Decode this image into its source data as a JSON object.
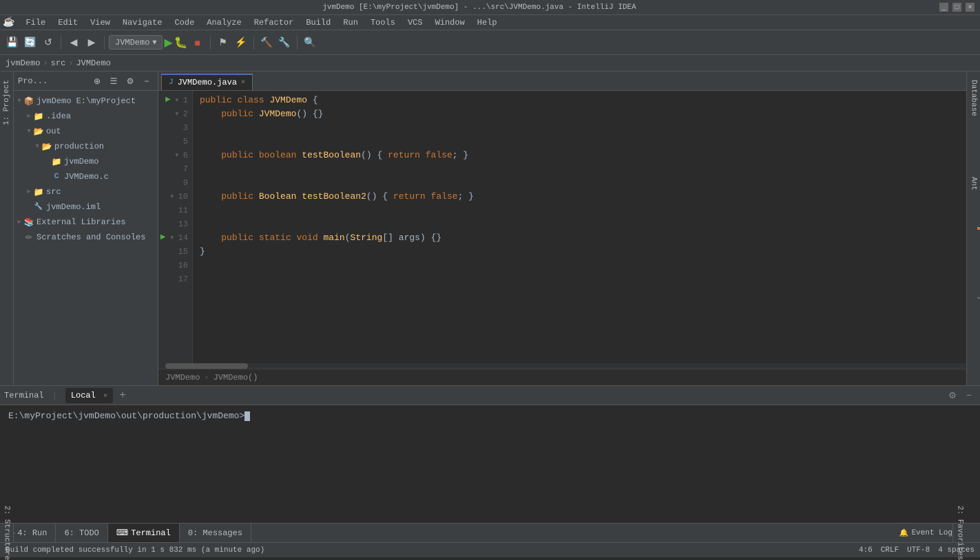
{
  "titleBar": {
    "title": "jvmDemo [E:\\myProject\\jvmDemo] - ...\\src\\JVMDemo.java - IntelliJ IDEA",
    "minimize": "_",
    "maximize": "□",
    "close": "×"
  },
  "menuBar": {
    "items": [
      "File",
      "Edit",
      "View",
      "Navigate",
      "Code",
      "Analyze",
      "Refactor",
      "Build",
      "Run",
      "Tools",
      "VCS",
      "Window",
      "Help"
    ]
  },
  "toolbar": {
    "runConfig": "JVMDemo",
    "buttons": [
      "save",
      "sync",
      "refresh",
      "back",
      "forward",
      "run",
      "debug",
      "stop",
      "build",
      "coverage",
      "profiler",
      "search"
    ]
  },
  "navBreadcrumb": {
    "items": [
      "jvmDemo",
      "src",
      "JVMDemo"
    ]
  },
  "projectPanel": {
    "title": "Pro...",
    "tree": [
      {
        "label": "jvmDemo E:\\myProject",
        "level": 0,
        "type": "module",
        "expanded": true,
        "hasArrow": true
      },
      {
        "label": ".idea",
        "level": 1,
        "type": "folder",
        "expanded": false,
        "hasArrow": true
      },
      {
        "label": "out",
        "level": 1,
        "type": "folder",
        "expanded": true,
        "hasArrow": true
      },
      {
        "label": "production",
        "level": 2,
        "type": "folder",
        "expanded": true,
        "hasArrow": true
      },
      {
        "label": "jvmDemo",
        "level": 3,
        "type": "folder",
        "expanded": false,
        "hasArrow": false
      },
      {
        "label": "JVMDemo.c",
        "level": 3,
        "type": "java",
        "expanded": false,
        "hasArrow": false
      },
      {
        "label": "src",
        "level": 1,
        "type": "folder",
        "expanded": false,
        "hasArrow": true
      },
      {
        "label": "jvmDemo.iml",
        "level": 1,
        "type": "iml",
        "expanded": false,
        "hasArrow": false
      },
      {
        "label": "External Libraries",
        "level": 0,
        "type": "folder",
        "expanded": false,
        "hasArrow": true
      },
      {
        "label": "Scratches and Consoles",
        "level": 0,
        "type": "folder",
        "expanded": false,
        "hasArrow": false
      }
    ]
  },
  "editorTabs": [
    {
      "label": "JVMDemo.java",
      "active": true
    }
  ],
  "codeLines": [
    {
      "num": 1,
      "runGutter": true,
      "foldGutter": false,
      "content": "public class JVMDemo {"
    },
    {
      "num": 2,
      "runGutter": false,
      "foldGutter": false,
      "content": "    public JVMDemo() {}"
    },
    {
      "num": 3,
      "runGutter": false,
      "foldGutter": false,
      "content": ""
    },
    {
      "num": 5,
      "runGutter": false,
      "foldGutter": false,
      "content": ""
    },
    {
      "num": 6,
      "runGutter": false,
      "foldGutter": true,
      "content": "    public boolean testBoolean() { return false; }"
    },
    {
      "num": 7,
      "runGutter": false,
      "foldGutter": false,
      "content": ""
    },
    {
      "num": 9,
      "runGutter": false,
      "foldGutter": false,
      "content": ""
    },
    {
      "num": 10,
      "runGutter": false,
      "foldGutter": true,
      "content": "    public Boolean testBoolean2() { return false; }"
    },
    {
      "num": 11,
      "runGutter": false,
      "foldGutter": false,
      "content": ""
    },
    {
      "num": 13,
      "runGutter": false,
      "foldGutter": false,
      "content": ""
    },
    {
      "num": 14,
      "runGutter": true,
      "foldGutter": true,
      "content": "    public static void main(String[] args) {}"
    },
    {
      "num": 15,
      "runGutter": false,
      "foldGutter": false,
      "content": "}"
    },
    {
      "num": 16,
      "runGutter": false,
      "foldGutter": false,
      "content": ""
    },
    {
      "num": 17,
      "runGutter": false,
      "foldGutter": false,
      "content": ""
    }
  ],
  "editorBreadcrumb": {
    "items": [
      "JVMDemo",
      "JVMDemo()"
    ]
  },
  "rightTabs": {
    "database": "Database",
    "ant": "Ant"
  },
  "terminalPanel": {
    "title": "Terminal",
    "tabs": [
      {
        "label": "Local",
        "active": true
      }
    ],
    "addLabel": "+",
    "prompt": "E:\\myProject\\jvmDemo\\out\\production\\jvmDemo>"
  },
  "bottomToolBar": {
    "tabs": [
      {
        "label": "4: Run",
        "icon": "▶",
        "active": false
      },
      {
        "label": "6: TODO",
        "icon": "",
        "active": false
      },
      {
        "label": "Terminal",
        "icon": "",
        "active": true
      },
      {
        "label": "0: Messages",
        "icon": "",
        "active": false
      }
    ]
  },
  "statusBar": {
    "message": "Build completed successfully in 1 s 832 ms (a minute ago)",
    "position": "4:6",
    "lineEnding": "CRLF",
    "encoding": "UTF-8",
    "indent": "4 spaces",
    "eventLog": "Event Log"
  }
}
